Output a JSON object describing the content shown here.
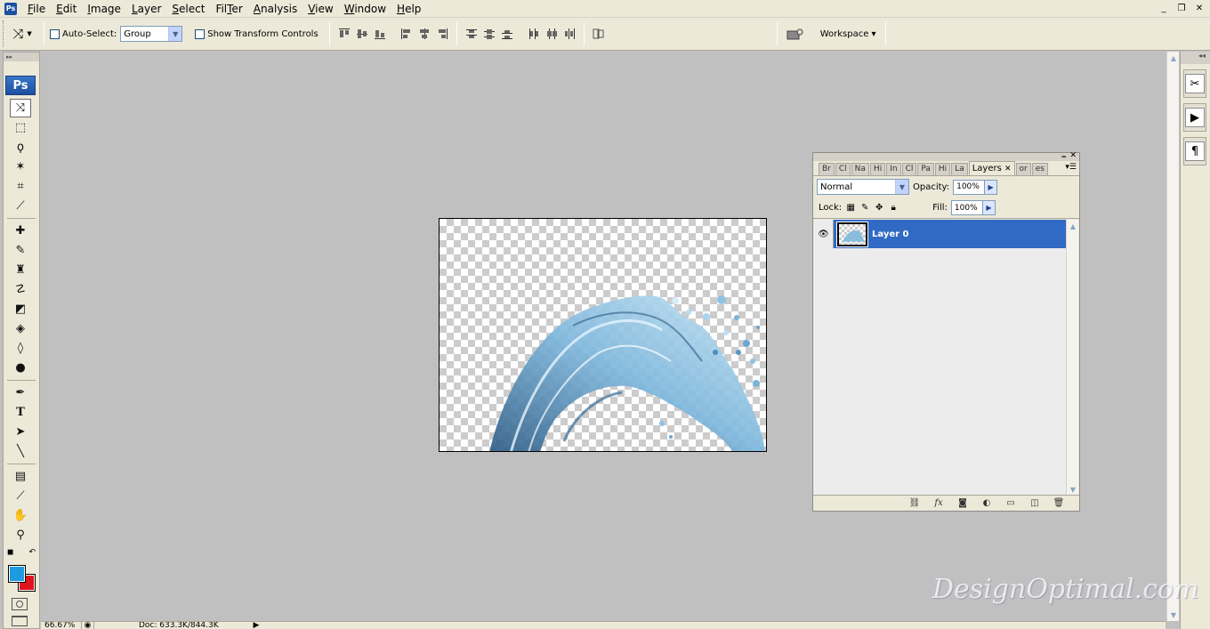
{
  "menubar": {
    "items": [
      {
        "label": "File",
        "accel": "F"
      },
      {
        "label": "Edit",
        "accel": "E"
      },
      {
        "label": "Image",
        "accel": "I"
      },
      {
        "label": "Layer",
        "accel": "L"
      },
      {
        "label": "Select",
        "accel": "S"
      },
      {
        "label": "Filter",
        "accel": "T"
      },
      {
        "label": "Analysis",
        "accel": "A"
      },
      {
        "label": "View",
        "accel": "V"
      },
      {
        "label": "Window",
        "accel": "W"
      },
      {
        "label": "Help",
        "accel": "H"
      }
    ],
    "app_icon": "Ps",
    "window_controls": {
      "minimize": "_",
      "restore": "❐",
      "close": "✕"
    }
  },
  "options": {
    "auto_select_label": "Auto-Select:",
    "auto_select_value": "Group",
    "transform_label": "Show Transform Controls",
    "workspace_label": "Workspace ▾"
  },
  "toolbox": {
    "logo": "Ps",
    "tools": [
      {
        "name": "move-tool-icon",
        "glyph": "⤨"
      },
      {
        "name": "marquee-tool-icon",
        "glyph": "⬚"
      },
      {
        "name": "lasso-tool-icon",
        "glyph": "ϙ"
      },
      {
        "name": "magic-wand-tool-icon",
        "glyph": "✶"
      },
      {
        "name": "crop-tool-icon",
        "glyph": "⌗"
      },
      {
        "name": "slice-tool-icon",
        "glyph": "⟋"
      },
      {
        "name": "healing-brush-tool-icon",
        "glyph": "✚"
      },
      {
        "name": "brush-tool-icon",
        "glyph": "✎"
      },
      {
        "name": "clone-stamp-tool-icon",
        "glyph": "♜"
      },
      {
        "name": "history-brush-tool-icon",
        "glyph": "☡"
      },
      {
        "name": "eraser-tool-icon",
        "glyph": "◩"
      },
      {
        "name": "paint-bucket-tool-icon",
        "glyph": "◈"
      },
      {
        "name": "blur-tool-icon",
        "glyph": "◊"
      },
      {
        "name": "dodge-tool-icon",
        "glyph": "●"
      },
      {
        "name": "pen-tool-icon",
        "glyph": "✒"
      },
      {
        "name": "type-tool-icon",
        "glyph": "T"
      },
      {
        "name": "path-selection-tool-icon",
        "glyph": "➤"
      },
      {
        "name": "line-tool-icon",
        "glyph": "╲"
      },
      {
        "name": "notes-tool-icon",
        "glyph": "▤"
      },
      {
        "name": "eyedropper-tool-icon",
        "glyph": "⟋"
      },
      {
        "name": "hand-tool-icon",
        "glyph": "✋"
      },
      {
        "name": "zoom-tool-icon",
        "glyph": "⚲"
      }
    ],
    "foreground_color": "#1e9be0",
    "background_color": "#e0141c"
  },
  "layers_panel": {
    "tabs": [
      "Br",
      "Cl",
      "Na",
      "Hi",
      "In",
      "Cl",
      "Pa",
      "Hi",
      "La",
      "Layers",
      "or",
      "es"
    ],
    "active_tab": "Layers",
    "blend_mode": "Normal",
    "opacity_label": "Opacity:",
    "opacity_value": "100%",
    "lock_label": "Lock:",
    "fill_label": "Fill:",
    "fill_value": "100%",
    "layers": [
      {
        "name": "Layer 0",
        "visible": true,
        "selected": true
      }
    ],
    "footer_icons": [
      "link-layers-icon",
      "layer-style-icon",
      "layer-mask-icon",
      "adjustment-layer-icon",
      "new-group-icon",
      "new-layer-icon",
      "delete-layer-icon"
    ]
  },
  "status": {
    "zoom": "66.67%",
    "doc_info": "Doc: 633.3K/844.3K"
  },
  "watermark": "DesignOptimal.com",
  "colors": {
    "selection_blue": "#316ac5",
    "chrome": "#ece9d8",
    "workspace_gray": "#c0c0c0"
  }
}
